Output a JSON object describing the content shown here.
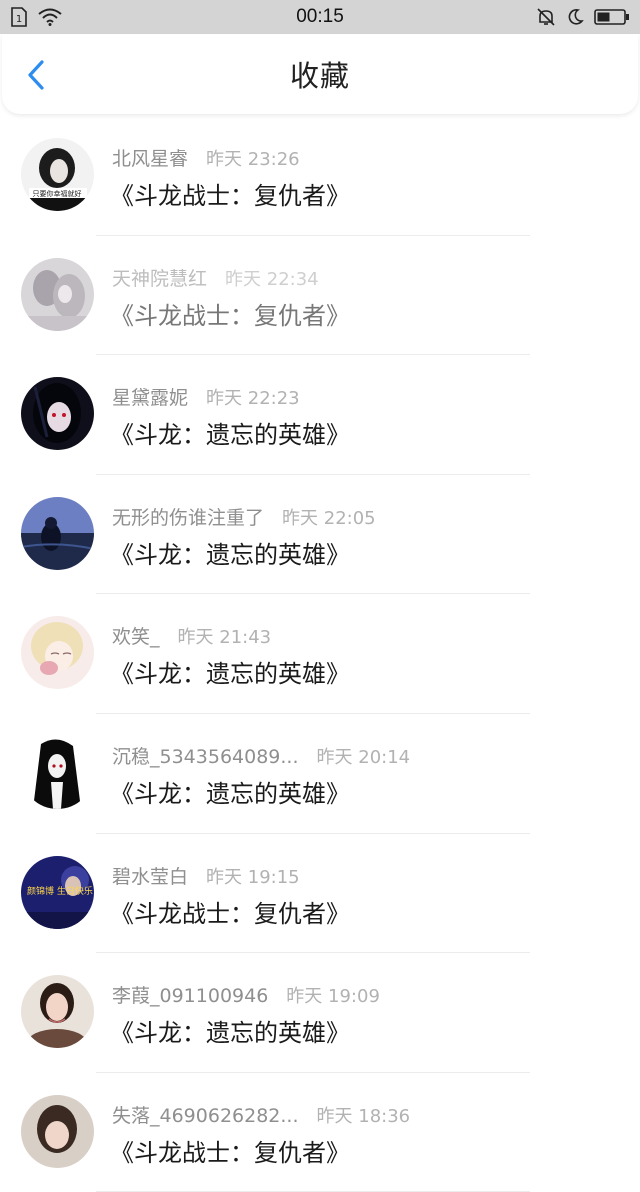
{
  "status_bar": {
    "time": "00:15"
  },
  "header": {
    "title": "收藏"
  },
  "items": [
    {
      "name": "北风星睿",
      "time": "昨天 23:26",
      "title": "《斗龙战士：复仇者》",
      "avatar_text": "只要你幸福就好",
      "dim": false
    },
    {
      "name": "天神院慧红",
      "time": "昨天 22:34",
      "title": "《斗龙战士：复仇者》",
      "dim": true
    },
    {
      "name": "星黛露妮",
      "time": "昨天 22:23",
      "title": "《斗龙：遗忘的英雄》",
      "dim": false
    },
    {
      "name": "无形的伤谁注重了",
      "time": "昨天 22:05",
      "title": "《斗龙：遗忘的英雄》",
      "dim": false
    },
    {
      "name": "欢笑_",
      "time": "昨天 21:43",
      "title": "《斗龙：遗忘的英雄》",
      "dim": false
    },
    {
      "name": "沉稳_5343564089...",
      "time": "昨天 20:14",
      "title": "《斗龙：遗忘的英雄》",
      "dim": false
    },
    {
      "name": "碧水莹白",
      "time": "昨天 19:15",
      "title": "《斗龙战士：复仇者》",
      "avatar_text": "颜锦博 生日快乐",
      "dim": false
    },
    {
      "name": "李葭_091100946",
      "time": "昨天 19:09",
      "title": "《斗龙：遗忘的英雄》",
      "dim": false
    },
    {
      "name": "失落_4690626282...",
      "time": "昨天 18:36",
      "title": "《斗龙战士：复仇者》",
      "dim": false
    }
  ],
  "colors": {
    "accent": "#2d8cf0",
    "status_bar_bg": "#d4d4d4"
  }
}
